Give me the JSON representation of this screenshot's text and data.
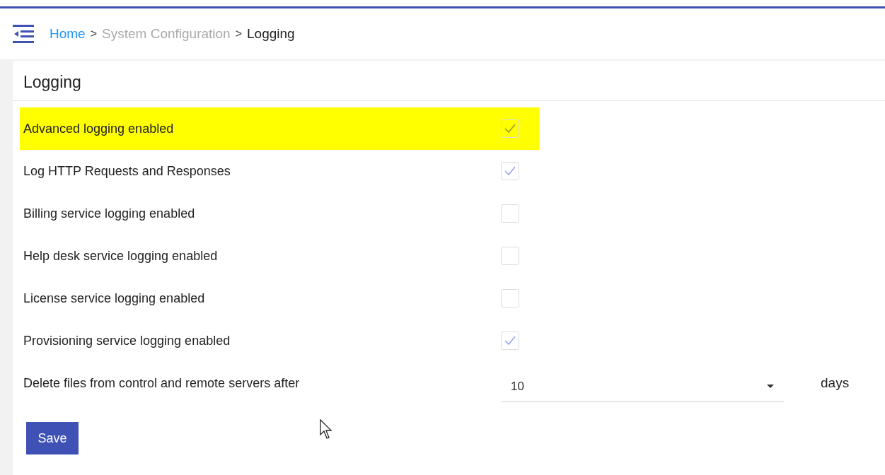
{
  "breadcrumb": [
    {
      "label": "Home",
      "kind": "link"
    },
    {
      "label": ">",
      "kind": "separator"
    },
    {
      "label": "System Configuration",
      "kind": "muted"
    },
    {
      "label": ">",
      "kind": "separator"
    },
    {
      "label": "Logging",
      "kind": "current"
    }
  ],
  "panel": {
    "title": "Logging",
    "settings": [
      {
        "label": "Advanced logging enabled",
        "checked": true,
        "highlighted": true
      },
      {
        "label": "Log HTTP Requests and Responses",
        "checked": true,
        "highlighted": false
      },
      {
        "label": "Billing service logging enabled",
        "checked": false,
        "highlighted": false
      },
      {
        "label": "Help desk service logging enabled",
        "checked": false,
        "highlighted": false
      },
      {
        "label": "License service logging enabled",
        "checked": false,
        "highlighted": false
      },
      {
        "label": "Provisioning service logging enabled",
        "checked": true,
        "highlighted": false
      }
    ],
    "retention": {
      "label": "Delete files from control and remote servers after",
      "value": "10",
      "unit": "days"
    },
    "save_button": "Save"
  }
}
